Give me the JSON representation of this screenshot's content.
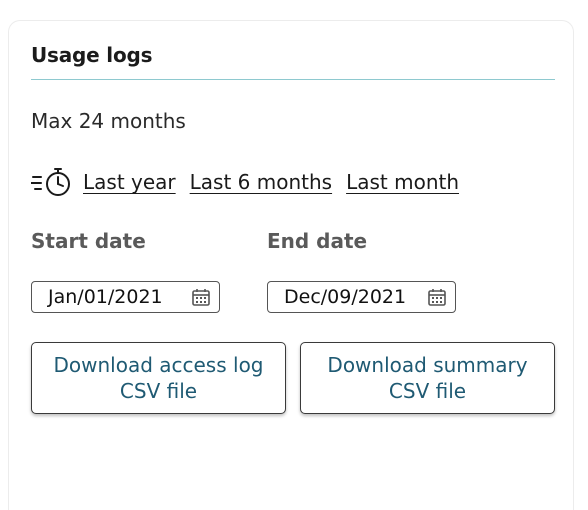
{
  "card": {
    "title": "Usage logs",
    "max_text": "Max 24 months"
  },
  "quick_ranges": {
    "icon": "timer-fast-icon",
    "links": [
      {
        "label": "Last year"
      },
      {
        "label": "Last 6 months"
      },
      {
        "label": "Last month"
      }
    ]
  },
  "start_date": {
    "label": "Start date",
    "value": "Jan/01/2021",
    "icon": "calendar-icon"
  },
  "end_date": {
    "label": "End date",
    "value": "Dec/09/2021",
    "icon": "calendar-icon"
  },
  "buttons": {
    "access_log": "Download access log CSV file",
    "summary": "Download summary CSV file"
  },
  "colors": {
    "accent_rule": "#8ec9cf",
    "button_text": "#1f5a73",
    "label_gray": "#5a5a5a"
  }
}
